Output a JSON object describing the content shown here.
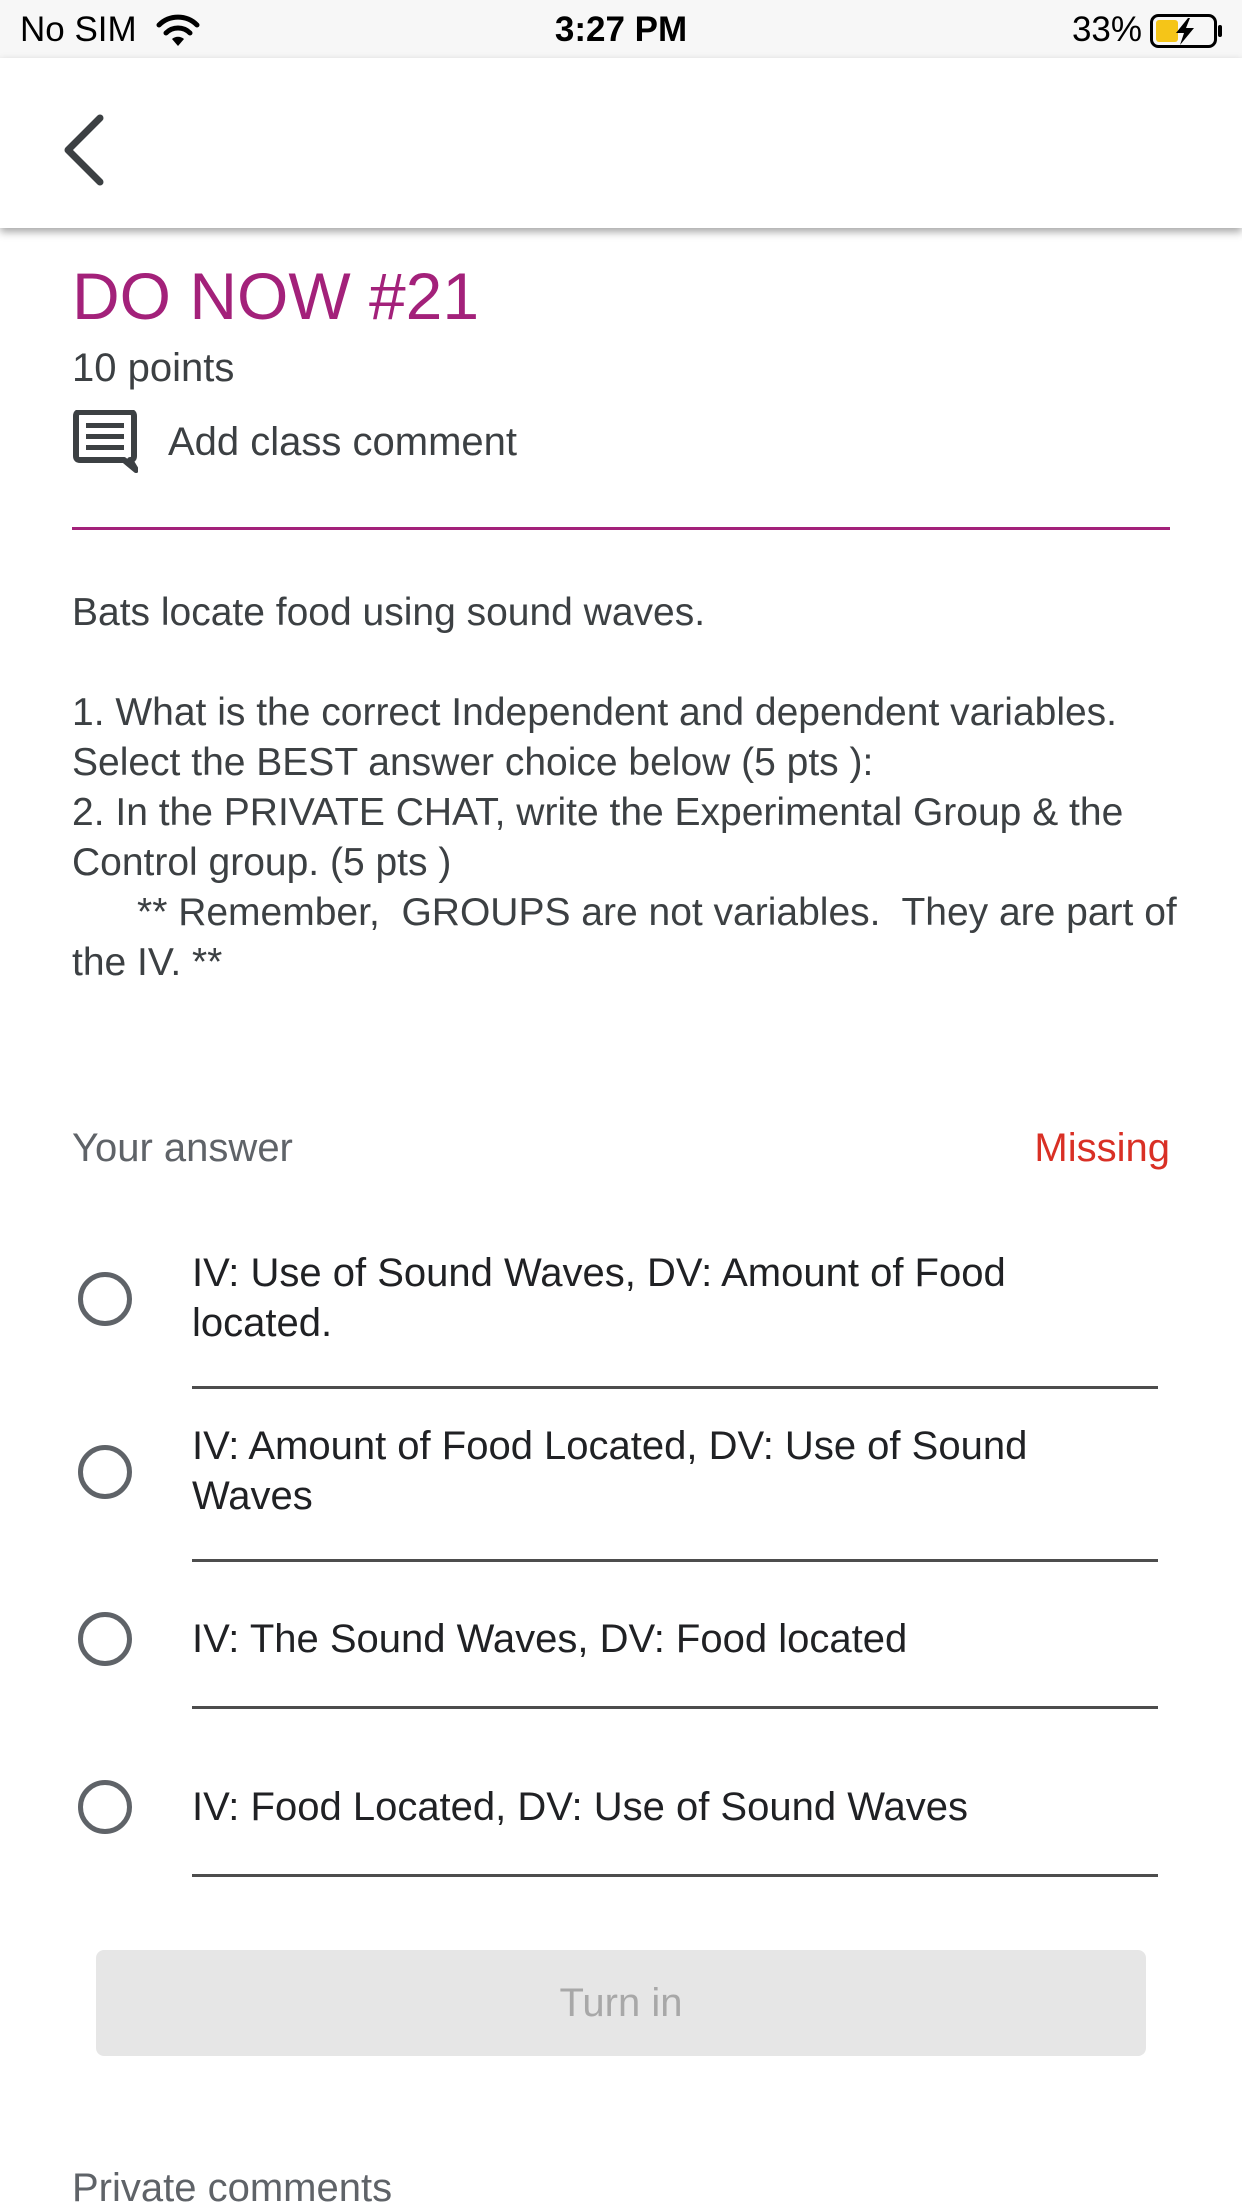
{
  "status_bar": {
    "carrier": "No SIM",
    "time": "3:27 PM",
    "battery_percent": "33%"
  },
  "header": {
    "back_icon": "chevron-left-icon"
  },
  "assignment": {
    "title": "DO NOW #21",
    "points": "10 points",
    "class_comment_label": "Add class comment",
    "comment_icon": "comment-icon",
    "accent_color": "#a3217a"
  },
  "instructions": [
    "Bats locate food using sound waves.",
    "",
    "1.  What is the correct Independent and dependent variables.  Select the BEST answer choice below (5 pts ):",
    "2.  In the PRIVATE CHAT, write the Experimental Group & the Control group.   (5 pts )",
    "      ** Remember,  GROUPS are not variables.  They are part of the IV. **"
  ],
  "answer": {
    "header_label": "Your answer",
    "status": "Missing",
    "status_color": "#d93025",
    "options": [
      "IV:  Use of Sound Waves, DV:  Amount of Food located.",
      "IV:  Amount of Food Located,  DV:  Use of Sound Waves",
      "IV:  The Sound Waves,  DV:  Food located",
      "IV:  Food Located,  DV:  Use of Sound Waves"
    ]
  },
  "actions": {
    "turn_in_label": "Turn in"
  },
  "private_comments": {
    "label": "Private comments"
  }
}
